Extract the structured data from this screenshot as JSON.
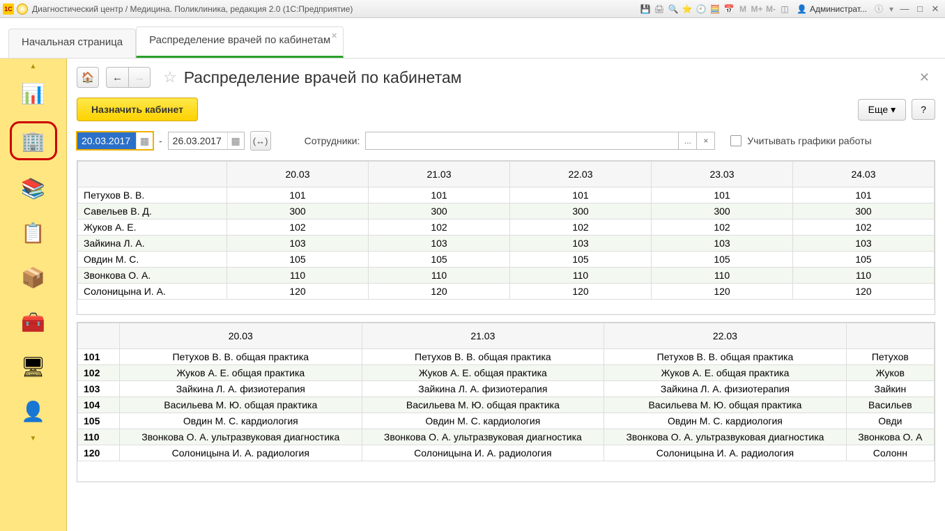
{
  "titlebar": {
    "app_logo_text": "1C",
    "title": "Диагностический центр / Медицина. Поликлиника, редакция 2.0  (1С:Предприятие)",
    "user_label": "Администрат..."
  },
  "tabs": {
    "home": "Начальная страница",
    "current": "Распределение врачей по кабинетам"
  },
  "page": {
    "title": "Распределение врачей по кабинетам",
    "assign_btn": "Назначить кабинет",
    "more_btn": "Еще",
    "help_btn": "?",
    "date_from": "20.03.2017",
    "date_dash": "-",
    "date_to": "26.03.2017",
    "emp_label": "Сотрудники:",
    "emp_value": "",
    "emp_ellipsis": "...",
    "emp_clear": "×",
    "chk_label": "Учитывать графики работы"
  },
  "top_table": {
    "headers": [
      "",
      "20.03",
      "21.03",
      "22.03",
      "23.03",
      "24.03"
    ],
    "rows": [
      [
        "Петухов В. В.",
        "101",
        "101",
        "101",
        "101",
        "101"
      ],
      [
        "Савельев В. Д.",
        "300",
        "300",
        "300",
        "300",
        "300"
      ],
      [
        "Жуков А. Е.",
        "102",
        "102",
        "102",
        "102",
        "102"
      ],
      [
        "Зайкина Л. А.",
        "103",
        "103",
        "103",
        "103",
        "103"
      ],
      [
        "Овдин М. С.",
        "105",
        "105",
        "105",
        "105",
        "105"
      ],
      [
        "Звонкова О. А.",
        "110",
        "110",
        "110",
        "110",
        "110"
      ],
      [
        "Солоницына И. А.",
        "120",
        "120",
        "120",
        "120",
        "120"
      ]
    ]
  },
  "bottom_table": {
    "headers": [
      "",
      "20.03",
      "21.03",
      "22.03",
      ""
    ],
    "rows": [
      [
        "101",
        "Петухов В. В. общая практика",
        "Петухов В. В. общая практика",
        "Петухов В. В. общая практика",
        "Петухов"
      ],
      [
        "102",
        "Жуков А. Е. общая практика",
        "Жуков А. Е. общая практика",
        "Жуков А. Е. общая практика",
        "Жуков"
      ],
      [
        "103",
        "Зайкина Л. А. физиотерапия",
        "Зайкина Л. А. физиотерапия",
        "Зайкина Л. А. физиотерапия",
        "Зайкин"
      ],
      [
        "104",
        "Васильева М. Ю. общая практика",
        "Васильева М. Ю. общая практика",
        "Васильева М. Ю. общая практика",
        "Васильев"
      ],
      [
        "105",
        "Овдин М. С. кардиология",
        "Овдин М. С. кардиология",
        "Овдин М. С. кардиология",
        "Овди"
      ],
      [
        "110",
        "Звонкова О. А. ультразвуковая диагностика",
        "Звонкова О. А. ультразвуковая диагностика",
        "Звонкова О. А. ультразвуковая диагностика",
        "Звонкова О. А"
      ],
      [
        "120",
        "Солоницына И. А. радиология",
        "Солоницына И. А. радиология",
        "Солоницына И. А. радиология",
        "Солонн"
      ]
    ]
  }
}
